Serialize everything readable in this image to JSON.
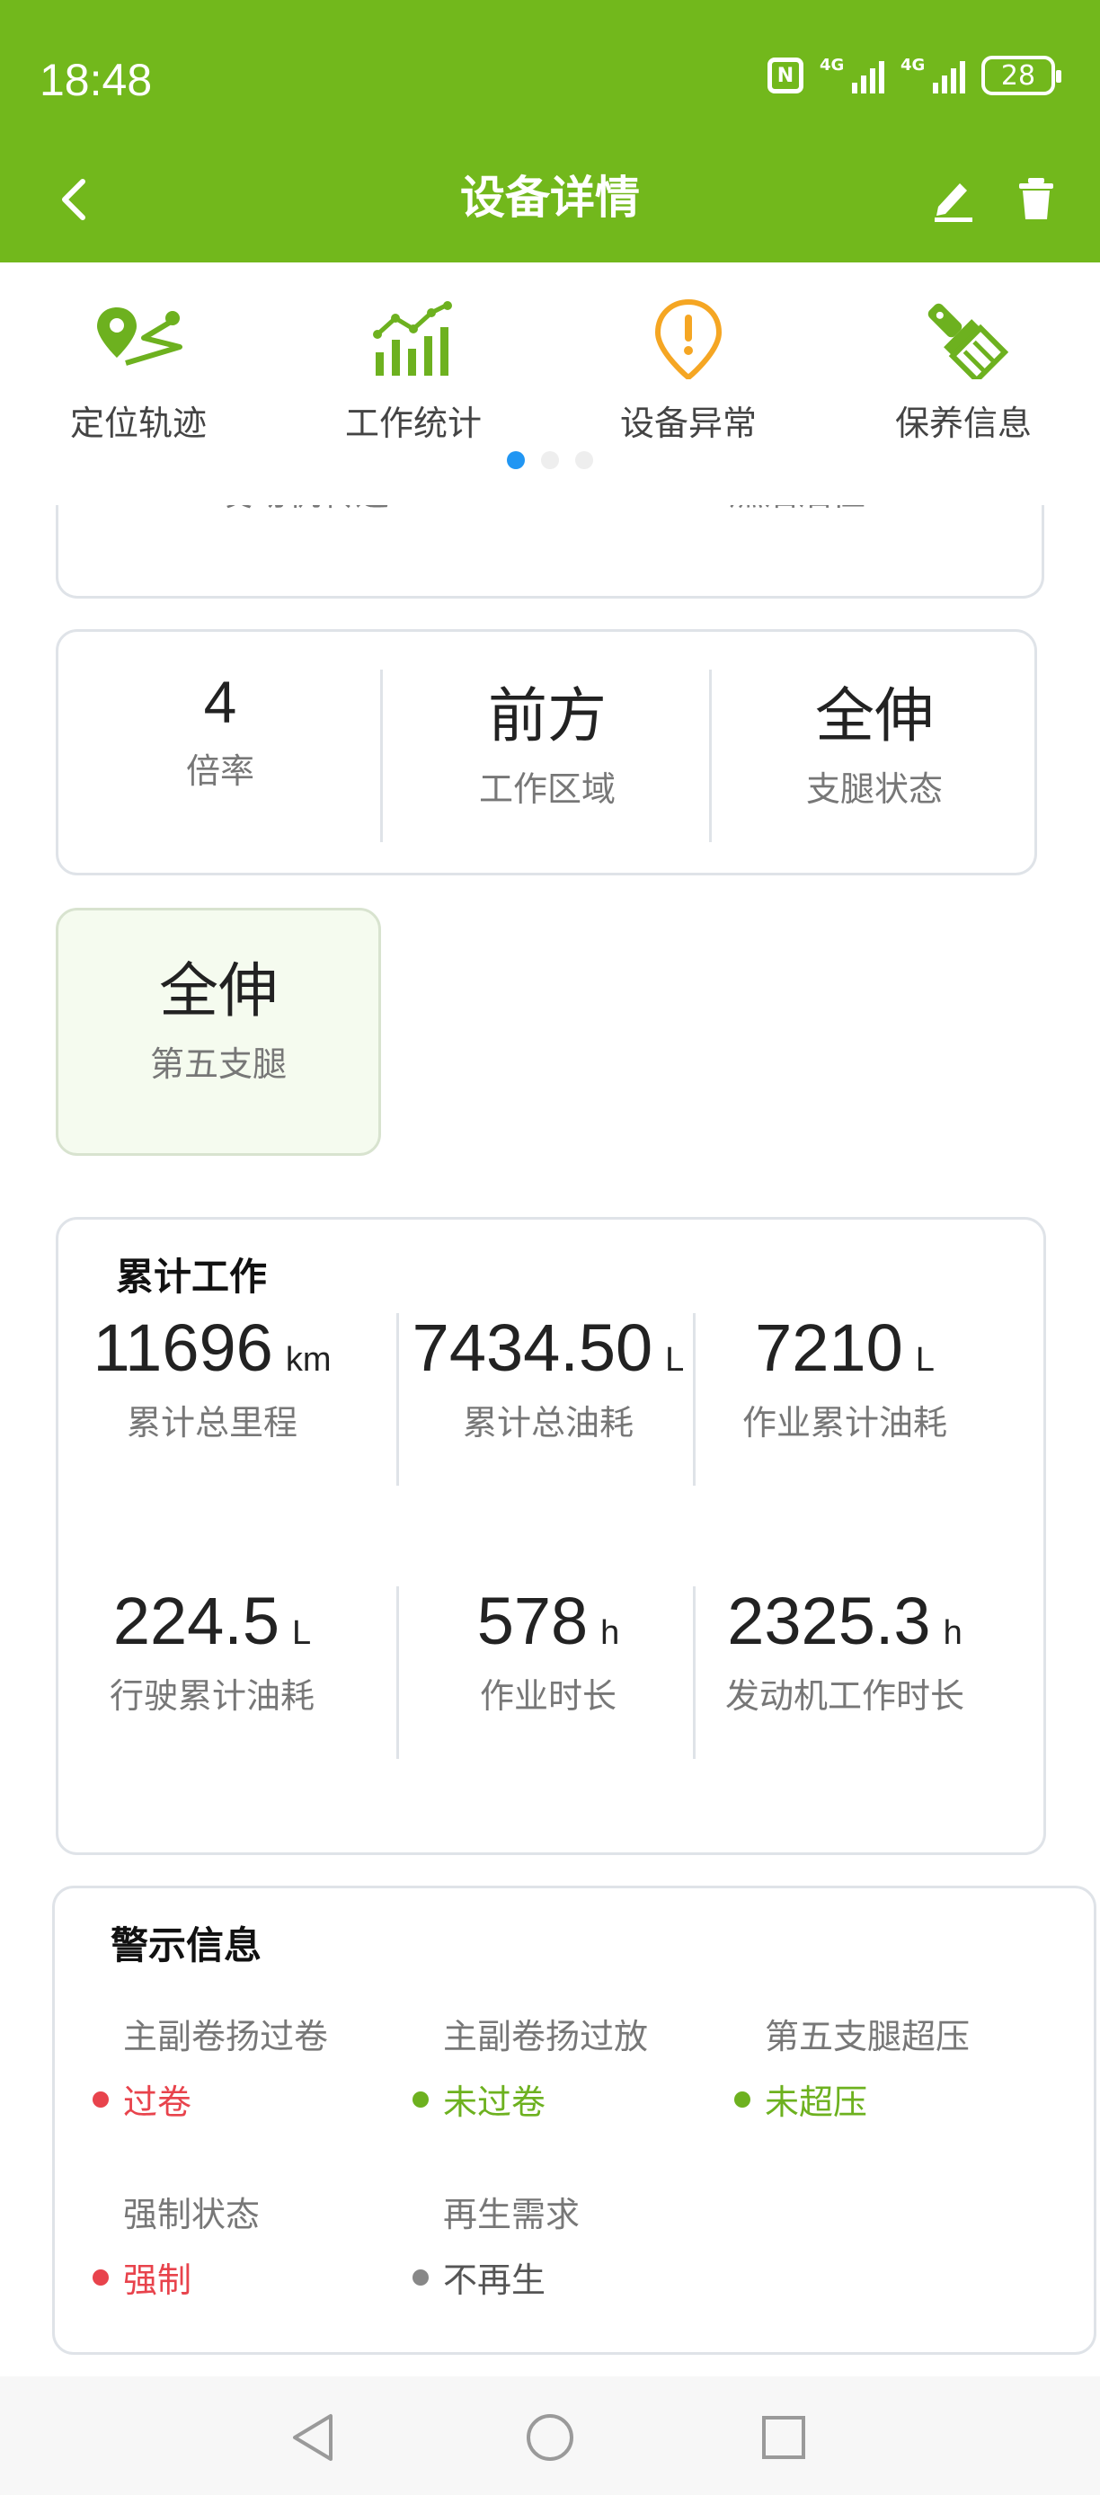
{
  "status_bar": {
    "time": "18:48",
    "nfc_label": "N",
    "signal1_label": "4G",
    "signal2_label": "4G",
    "battery": "28"
  },
  "header": {
    "title": "设备详情",
    "back_icon": "chevron-left-icon",
    "edit_icon": "pencil-icon",
    "delete_icon": "trash-icon"
  },
  "menu": {
    "items": [
      {
        "label": "定位轨迹",
        "icon": "location-track-icon"
      },
      {
        "label": "工作统计",
        "icon": "bar-chart-icon"
      },
      {
        "label": "设备异常",
        "icon": "alert-icon"
      },
      {
        "label": "保养信息",
        "icon": "brush-icon"
      }
    ],
    "page_count": 3,
    "active_page": 1
  },
  "partial_card": {
    "left_label": "发动机转速",
    "right_label": "燃油油位"
  },
  "status_card": {
    "items": [
      {
        "value": "4",
        "label": "倍率"
      },
      {
        "value": "前方",
        "label": "工作区域"
      },
      {
        "value": "全伸",
        "label": "支腿状态"
      }
    ]
  },
  "fifth_leg": {
    "value": "全伸",
    "label": "第五支腿"
  },
  "cumulative": {
    "title": "累计工作",
    "items": [
      {
        "value": "11696",
        "unit": "km",
        "label": "累计总里程"
      },
      {
        "value": "7434.50",
        "unit": "L",
        "label": "累计总油耗"
      },
      {
        "value": "7210",
        "unit": "L",
        "label": "作业累计油耗"
      },
      {
        "value": "224.5",
        "unit": "L",
        "label": "行驶累计油耗"
      },
      {
        "value": "578",
        "unit": "h",
        "label": "作业时长"
      },
      {
        "value": "2325.3",
        "unit": "h",
        "label": "发动机工作时长"
      }
    ]
  },
  "warnings": {
    "title": "警示信息",
    "items": [
      {
        "label": "主副卷扬过卷",
        "value": "过卷",
        "color": "#e8434c"
      },
      {
        "label": "主副卷扬过放",
        "value": "未过卷",
        "color": "#6db11f"
      },
      {
        "label": "第五支腿超压",
        "value": "未超压",
        "color": "#6db11f"
      },
      {
        "label": "强制状态",
        "value": "强制",
        "color": "#e8434c"
      },
      {
        "label": "再生需求",
        "value": "不再生",
        "color": "#555555"
      }
    ]
  },
  "colors": {
    "brand_green": "#72b81c",
    "icon_green": "#6db11f",
    "icon_orange": "#f5a623",
    "active_dot": "#2196f3"
  }
}
